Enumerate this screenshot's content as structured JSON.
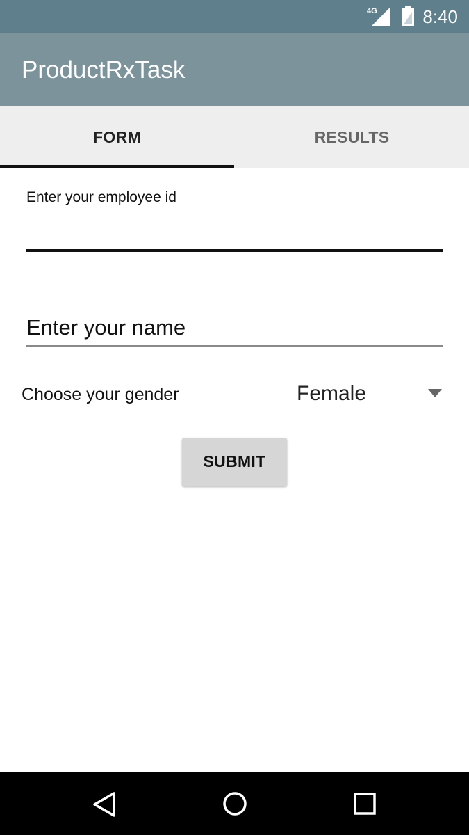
{
  "status_bar": {
    "network": "4G",
    "time": "8:40",
    "icons": [
      "signal-icon",
      "battery-icon"
    ]
  },
  "app_bar": {
    "title": "ProductRxTask"
  },
  "tabs": [
    {
      "label": "FORM",
      "selected": true
    },
    {
      "label": "RESULTS",
      "selected": false
    }
  ],
  "form": {
    "employee_id": {
      "label": "Enter your employee id",
      "value": ""
    },
    "name": {
      "placeholder": "Enter your name",
      "value": ""
    },
    "gender": {
      "label": "Choose your gender",
      "selected": "Female"
    },
    "submit_label": "SUBMIT"
  },
  "nav_bar": {
    "icons": [
      "back-icon",
      "home-icon",
      "recents-icon"
    ]
  }
}
